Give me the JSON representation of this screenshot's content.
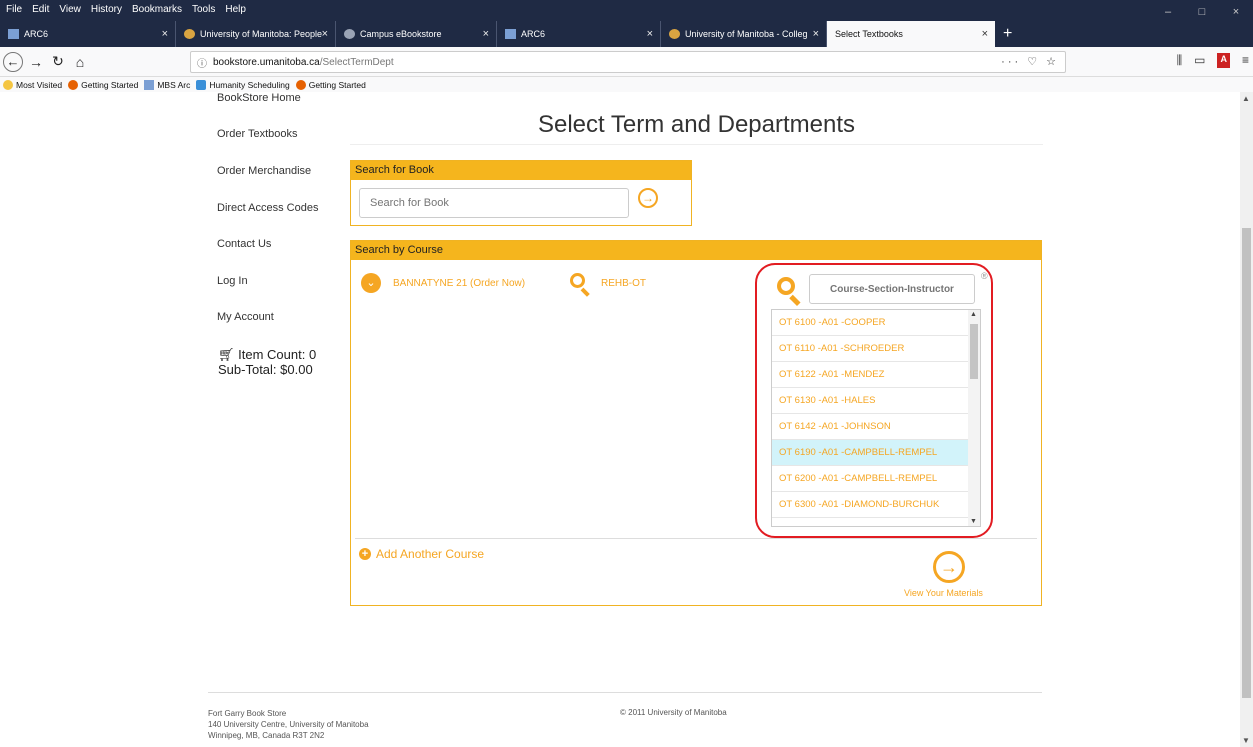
{
  "menubar": {
    "items": [
      "File",
      "Edit",
      "View",
      "History",
      "Bookmarks",
      "Tools",
      "Help"
    ],
    "window_controls": [
      "–",
      "□",
      "×"
    ]
  },
  "tabs": [
    {
      "label": "ARC6"
    },
    {
      "label": "University of Manitoba: People"
    },
    {
      "label": "Campus eBookstore"
    },
    {
      "label": "ARC6"
    },
    {
      "label": "University of Manitoba - Colleg"
    },
    {
      "label": "Select Textbooks"
    }
  ],
  "tab_close": "×",
  "new_tab": "+",
  "navbar": {
    "url_host": "bookstore.umanitoba.ca",
    "url_path": "/SelectTermDept",
    "url_actions": "··· ♡ ☆"
  },
  "bookmarks": [
    "Most Visited",
    "Getting Started",
    "MBS Arc",
    "Humanity Scheduling",
    "Getting Started"
  ],
  "sidenav": {
    "items": [
      "BookStore Home",
      "Order Textbooks",
      "Order Merchandise",
      "Direct Access Codes",
      "Contact Us",
      "Log In",
      "My Account"
    ]
  },
  "cart": {
    "item_count": "Item Count: 0",
    "subtotal": "Sub-Total: $0.00"
  },
  "page_title": "Select Term and Departments",
  "search_book": {
    "header": "Search for Book",
    "placeholder": "Search for Book"
  },
  "search_course": {
    "header": "Search by Course",
    "term": "BANNATYNE 21 (Order Now)",
    "department": "REHB-OT",
    "placeholder": "Course-Section-Instructor",
    "registered_mark": "®",
    "options": [
      "OT 6100 -A01 -COOPER",
      "OT 6110 -A01 -SCHROEDER",
      "OT 6122 -A01 -MENDEZ",
      "OT 6130 -A01 -HALES",
      "OT 6142 -A01 -JOHNSON",
      "OT 6190 -A01 -CAMPBELL-REMPEL",
      "OT 6200 -A01 -CAMPBELL-REMPEL",
      "OT 6300 -A01 -DIAMOND-BURCHUK"
    ],
    "highlighted_index": 5,
    "add_course": "Add Another Course",
    "view_materials": "View Your Materials"
  },
  "footer": {
    "line1": "Fort Garry Book Store",
    "line2": "140 University Centre, University of Manitoba",
    "line3": "Winnipeg, MB, Canada R3T 2N2",
    "copyright": "© 2011 University of Manitoba"
  },
  "colors": {
    "accent": "#f5a623",
    "panel_header": "#f5b51d",
    "highlight_ring": "#e21c22",
    "chrome": "#1f2a44"
  }
}
